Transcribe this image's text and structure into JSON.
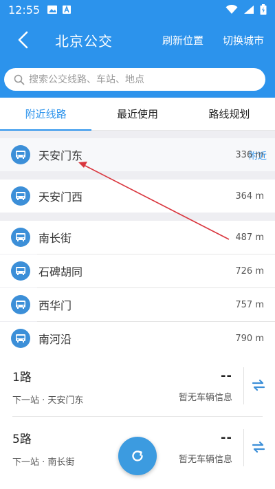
{
  "statusbar": {
    "time": "12:55"
  },
  "appbar": {
    "title": "北京公交",
    "refresh_label": "刷新位置",
    "switch_city_label": "切换城市"
  },
  "search": {
    "placeholder": "搜索公交线路、车站、地点"
  },
  "tabs": [
    {
      "label": "附近线路",
      "active": true
    },
    {
      "label": "最近使用",
      "active": false
    },
    {
      "label": "路线规划",
      "active": false
    }
  ],
  "stations": [
    {
      "name": "天安门东",
      "badge": "附近",
      "distance": "336 m"
    },
    {
      "name": "天安门西",
      "distance": "364 m"
    },
    {
      "name": "南长街",
      "distance": "487 m"
    },
    {
      "name": "石碑胡同",
      "distance": "726 m"
    },
    {
      "name": "西华门",
      "distance": "757 m"
    },
    {
      "name": "南河沿",
      "distance": "790 m"
    }
  ],
  "routes": [
    {
      "name": "1路",
      "next_stop": "下一站 · 天安门东",
      "eta": "--",
      "status": "暂无车辆信息"
    },
    {
      "name": "5路",
      "next_stop": "下一站 · 南长街",
      "eta": "--",
      "status": "暂无车辆信息"
    }
  ],
  "colors": {
    "primary": "#2c93ec",
    "station_icon": "#3c8fd8",
    "annotation_arrow": "#d9363e"
  },
  "icons": {
    "back": "back-arrow-icon",
    "search": "search-icon",
    "station": "bus-icon",
    "swap": "swap-direction-icon",
    "refresh": "refresh-icon"
  }
}
